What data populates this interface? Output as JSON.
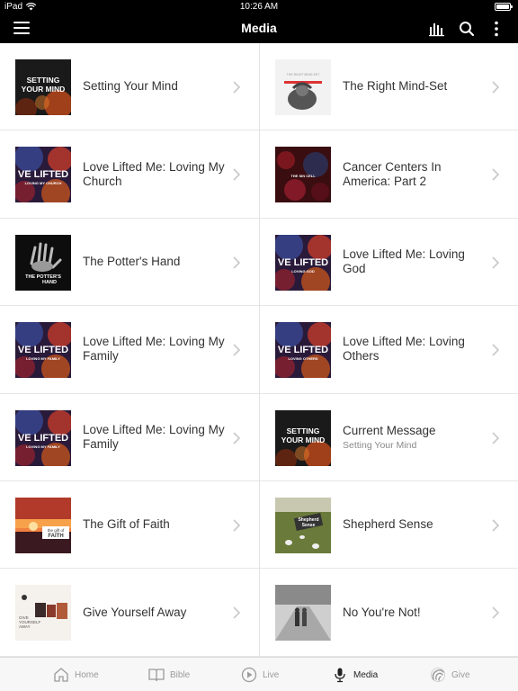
{
  "status_bar": {
    "carrier": "iPad",
    "time": "10:26 AM"
  },
  "navbar": {
    "title": "Media",
    "icons": [
      "menu-icon",
      "equalizer-icon",
      "search-icon",
      "more-vertical-icon"
    ]
  },
  "left_column": [
    {
      "title": "Setting Your Mind",
      "thumb": "setting-your-mind",
      "thumb_lines": [
        "SETTING",
        "YOUR MIND"
      ]
    },
    {
      "title": "Love Lifted Me: Loving My Church",
      "thumb": "love-lifted",
      "thumb_lines": [
        "VE LIFTED",
        "LOVING MY CHURCH"
      ]
    },
    {
      "title": "The Potter's Hand",
      "thumb": "potters-hand",
      "thumb_lines": [
        "THE POTTER'S",
        "HAND"
      ]
    },
    {
      "title": "Love Lifted Me: Loving My Family",
      "thumb": "love-lifted",
      "thumb_lines": [
        "VE LIFTED",
        "LOVING MY FAMILY"
      ]
    },
    {
      "title": "Love Lifted Me: Loving My Family",
      "thumb": "love-lifted",
      "thumb_lines": [
        "VE LIFTED",
        "LOVING MY FAMILY"
      ]
    },
    {
      "title": "The Gift of Faith",
      "thumb": "gift-of-faith",
      "thumb_lines": [
        "the gift of",
        "FAITH"
      ]
    },
    {
      "title": "Give Yourself Away",
      "thumb": "give-yourself-away",
      "thumb_lines": [
        "GIVE",
        "YOURSELF",
        "AWAY"
      ]
    }
  ],
  "right_column": [
    {
      "title": "The Right Mind-Set",
      "thumb": "right-mind-set",
      "thumb_lines": [
        "THE RIGHT MIND-SET"
      ]
    },
    {
      "title": "Cancer Centers In America: Part 2",
      "thumb": "sin-cell",
      "thumb_lines": [
        "THE SIN CELL"
      ]
    },
    {
      "title": "Love Lifted Me: Loving God",
      "thumb": "love-lifted",
      "thumb_lines": [
        "VE LIFTED",
        "LOVING GOD"
      ]
    },
    {
      "title": "Love Lifted Me: Loving Others",
      "thumb": "love-lifted",
      "thumb_lines": [
        "VE LIFTED",
        "LOVING OTHERS"
      ]
    },
    {
      "title": "Current Message",
      "subtitle": "Setting Your Mind",
      "thumb": "setting-your-mind",
      "thumb_lines": [
        "SETTING",
        "YOUR MIND"
      ]
    },
    {
      "title": "Shepherd Sense",
      "thumb": "shepherd-sense",
      "thumb_lines": [
        "Shepherd",
        "Sense"
      ]
    },
    {
      "title": "No You're Not!",
      "thumb": "no-youre-not",
      "thumb_lines": []
    }
  ],
  "tabbar": {
    "active": "Media",
    "tabs": [
      {
        "label": "Home",
        "icon": "home-icon"
      },
      {
        "label": "Bible",
        "icon": "book-icon"
      },
      {
        "label": "Live",
        "icon": "play-circle-icon"
      },
      {
        "label": "Media",
        "icon": "microphone-icon"
      },
      {
        "label": "Give",
        "icon": "give-icon"
      }
    ]
  },
  "colors": {
    "bar_bg": "#000000",
    "text": "#333333",
    "subtext": "#8a8a8a",
    "tab_inactive": "#9a9a9a",
    "tab_active": "#222222"
  }
}
